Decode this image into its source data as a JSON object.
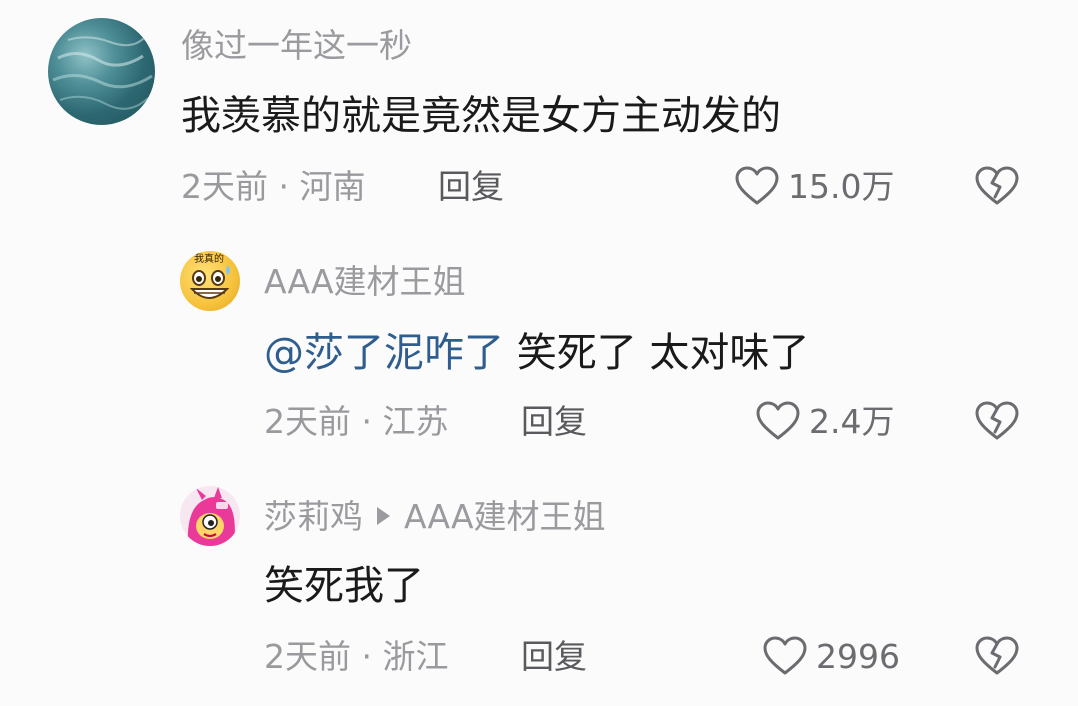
{
  "comments": [
    {
      "user": "像过一年这一秒",
      "text": "我羡慕的就是竟然是女方主动发的",
      "time_location": "2天前 · 河南",
      "reply_label": "回复",
      "likes": "15.0万",
      "avatar_icon": "ocean-avatar"
    },
    {
      "user": "AAA建材王姐",
      "mention": "@莎了泥咋了",
      "text": " 笑死了 太对味了",
      "time_location": "2天前 · 江苏",
      "reply_label": "回复",
      "likes": "2.4万",
      "avatar_icon": "grinning-face-avatar",
      "avatar_caption": "我真的"
    },
    {
      "user": "莎莉鸡",
      "reply_to": "AAA建材王姐",
      "text": "笑死我了",
      "time_location": "2天前 · 浙江",
      "reply_label": "回复",
      "likes": "2996",
      "avatar_icon": "pink-cartoon-avatar"
    }
  ],
  "colors": {
    "mention": "#2f5d8d",
    "meta": "#9a9a9e",
    "text": "#1a1a1a"
  }
}
